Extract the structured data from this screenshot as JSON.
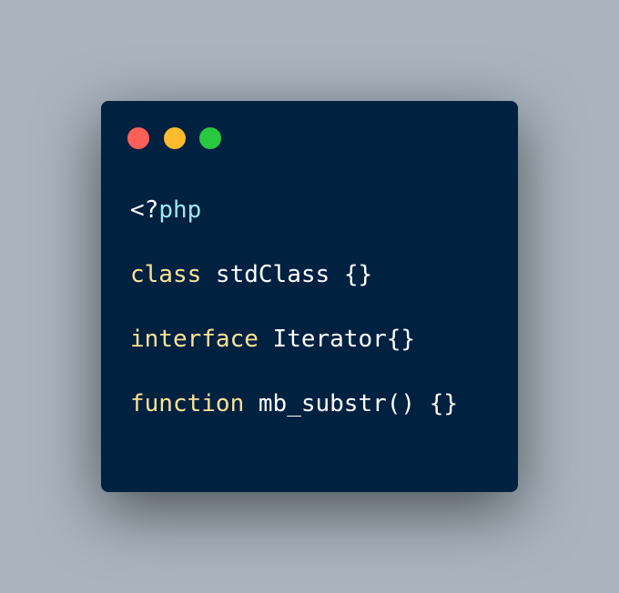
{
  "window": {
    "controls": [
      {
        "name": "close",
        "color": "#fe5f57"
      },
      {
        "name": "minimize",
        "color": "#febc2e"
      },
      {
        "name": "maximize",
        "color": "#28c840"
      }
    ]
  },
  "code": {
    "lines": [
      {
        "open_tag": "<?",
        "tag_name": "php"
      },
      {
        "keyword": "class",
        "rest": " stdClass {}"
      },
      {
        "keyword": "interface",
        "rest": " Iterator{}"
      },
      {
        "keyword": "function",
        "rest": " mb_substr() {}"
      }
    ]
  },
  "colors": {
    "background": "#a9b4bf",
    "editor_background": "#012141",
    "keyword": "#fbe396",
    "php_tag": "#9ee7f4",
    "text": "#ffffff"
  }
}
